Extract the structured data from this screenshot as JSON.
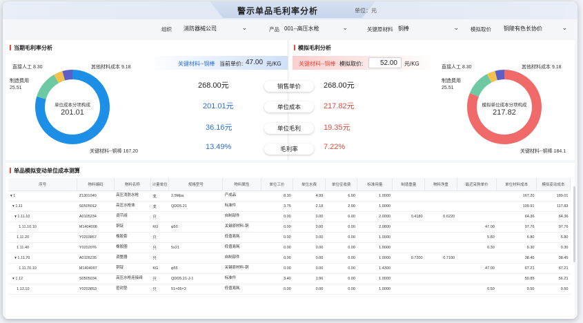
{
  "header": {
    "title": "警示单品毛利率分析",
    "unit": "单位：元"
  },
  "filters": [
    {
      "label": "组织",
      "value": "消防器械公司"
    },
    {
      "label": "产品",
      "value": "001--高压水枪"
    },
    {
      "label": "关键原材料",
      "value": "铜棒"
    },
    {
      "label": "模拟取价",
      "value": "铜陵有色长协价"
    }
  ],
  "left": {
    "title": "当期毛利率分析",
    "donut_center_label": "单位成本分项构成",
    "donut_center_value": "201.01",
    "labels": {
      "direct_labor": "直接人工 8.30",
      "other_material": "其他材料成本 9.18",
      "manufacturing_name": "制造费用",
      "manufacturing_value": "25.51",
      "key_material": "关键材料--铜棒 167.20"
    },
    "band_material": "关键材料--铜棒",
    "band_price_label": "当前单价:",
    "band_price_value": "47.00",
    "band_unit": "元/KG",
    "values": [
      "268.00元",
      "201.01元",
      "36.16元",
      "13.49%"
    ],
    "donut": [
      {
        "name": "关键材料--铜棒",
        "value": 167.2,
        "color": "#1e8fe6"
      },
      {
        "name": "制造费用",
        "value": 25.51,
        "color": "#6cc9a2"
      },
      {
        "name": "直接人工",
        "value": 8.3,
        "color": "#f2c14e"
      },
      {
        "name": "其他材料成本",
        "value": 9.18,
        "color": "#5b5fc7"
      }
    ]
  },
  "middle": {
    "buttons": [
      "销售单价",
      "单位成本",
      "单位毛利",
      "毛利率"
    ]
  },
  "right": {
    "title": "模拟毛利分析",
    "donut_center_label": "模拟单位成本分项构成",
    "donut_center_value": "217.82",
    "labels": {
      "direct_labor": "直接人工 8.30",
      "other_material": "其他材料成本 9.18",
      "manufacturing_name": "制造费用",
      "manufacturing_value": "25.51",
      "key_material": "关键材料--铜棒 184.1"
    },
    "band_material": "关键材料--铜棒",
    "band_price_label": "模拟取价:",
    "band_price_value": "52.00",
    "band_unit": "元/KG",
    "values": [
      "268.00元",
      "217.82元",
      "19.35元",
      "7.22%"
    ],
    "donut": [
      {
        "name": "关键材料--铜棒",
        "value": 184.1,
        "color": "#f06a6a"
      },
      {
        "name": "制造费用",
        "value": 25.51,
        "color": "#6cc9a2"
      },
      {
        "name": "直接人工",
        "value": 8.3,
        "color": "#f2c14e"
      },
      {
        "name": "其他材料成本",
        "value": 9.18,
        "color": "#5b5fc7"
      }
    ]
  },
  "table": {
    "title": "单品模拟变动单位成本测算",
    "columns": [
      "序号",
      "物料编码",
      "物料名称",
      "计量单位",
      "规格型号",
      "物料属性",
      "单位工价",
      "单位水费",
      "单位征收费",
      "标准用量",
      "制造重量",
      "物料净重",
      "最近采购单价",
      "单位材料成本",
      "模拟变动成本"
    ],
    "rows": [
      [
        "▾ 1",
        "Z1301040",
        "高压消防水枪",
        "支",
        "2.5Mpa",
        "产成品",
        "8.30",
        "4.99",
        "6.00",
        "1.0000",
        "",
        "",
        "",
        "167.20",
        "189.01"
      ],
      [
        "  ▾ 1.11",
        "S0505012",
        "高压水枪体",
        "支",
        "QDD5.21",
        "标准件",
        "3.75",
        "2.18",
        "2.00",
        "1.0000",
        "",
        "",
        "",
        "109.91",
        "117.83"
      ],
      [
        "    ▾ 1.11.10",
        "A0105234",
        "调节阀",
        "只",
        "",
        "自制部件",
        "0.00",
        "0.00",
        "0.00",
        "2.0000",
        "0.4180",
        "0.6220",
        "",
        "64.36",
        "64.36"
      ],
      [
        "        1.11.10.10",
        "M1404008",
        "铜锭",
        "KG",
        "φ50",
        "关键原材料-铜",
        "0.00",
        "0.00",
        "0.00",
        "2.0800",
        "",
        "",
        "47.00",
        "97.76",
        "97.76"
      ],
      [
        "      1.11.20",
        "Y0203857",
        "橡胶套",
        "只",
        "",
        "低值易耗",
        "0.00",
        "0.00",
        "0.00",
        "1.0000",
        "",
        "",
        "5.80",
        "6.80",
        "6.80"
      ],
      [
        "      1.11.40",
        "Y0202076",
        "橡胶圈",
        "只",
        "5x21",
        "低值易耗",
        "0.00",
        "0.00",
        "0.00",
        "1.0000",
        "",
        "",
        "0.30",
        "0.30",
        "0.30"
      ],
      [
        "    ▾ 1.11.70",
        "A0105235",
        "调整器",
        "只",
        "",
        "自制部件",
        "0.00",
        "0.00",
        "0.00",
        "1.0000",
        "0.7200",
        "0.7100",
        "",
        "38.45",
        "38.45"
      ],
      [
        "        1.11.70.10",
        "M1404007",
        "铜锭",
        "KG",
        "φ55",
        "关键原材料-铜",
        "0.00",
        "0.00",
        "0.00",
        "1.4300",
        "",
        "",
        "47.00",
        "67.21",
        "67.21"
      ],
      [
        "  ▾ 1.12",
        "S0505034",
        "高压水枪连接阀",
        "只",
        "QDD5.21-J-1",
        "标准件",
        "3.40",
        "1.96",
        "0.00",
        "1.0000",
        "",
        "",
        "",
        "50.85",
        "56.21"
      ],
      [
        "      1.12.10",
        "Y0203853",
        "密封垫",
        "只",
        "51×65×3",
        "低值易耗",
        "0.00",
        "0.00",
        "0.00",
        "1.0000",
        "",
        "",
        "0.50",
        "0.50",
        "0.50"
      ]
    ]
  }
}
